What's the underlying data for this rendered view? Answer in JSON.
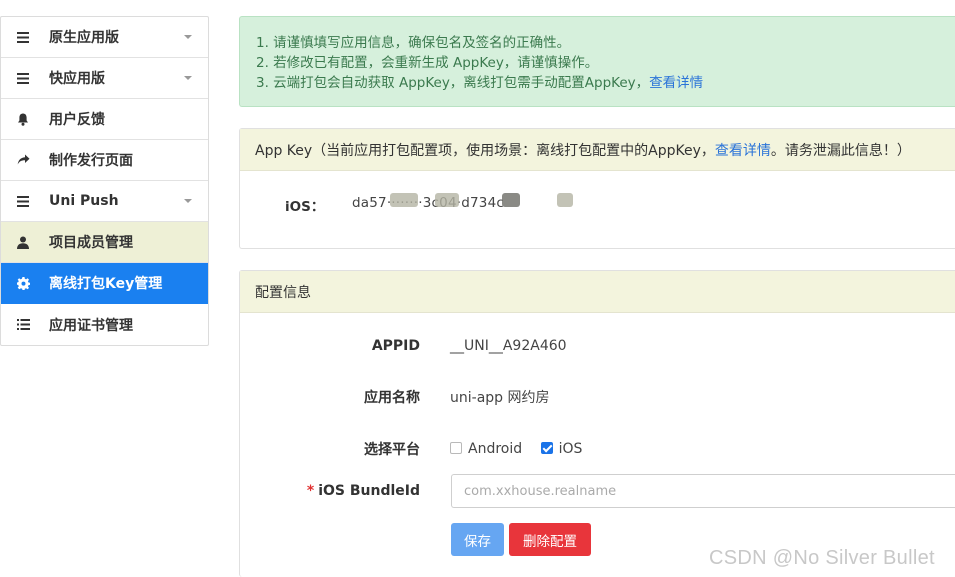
{
  "sidebar": {
    "items": [
      {
        "label": "原生应用版",
        "icon": "menu-icon",
        "has_caret": true
      },
      {
        "label": "快应用版",
        "icon": "menu-icon",
        "has_caret": true
      },
      {
        "label": "用户反馈",
        "icon": "bell-icon",
        "has_caret": false
      },
      {
        "label": "制作发行页面",
        "icon": "share-arrow-icon",
        "has_caret": false
      },
      {
        "label": "Uni Push",
        "icon": "menu-icon",
        "has_caret": true
      },
      {
        "label": "项目成员管理",
        "icon": "user-icon",
        "has_caret": false
      },
      {
        "label": "离线打包Key管理",
        "icon": "gear-icon",
        "has_caret": false,
        "active": true
      },
      {
        "label": "应用证书管理",
        "icon": "list-icon",
        "has_caret": false
      }
    ]
  },
  "notice": {
    "line1": "1. 请谨慎填写应用信息，确保包名及签名的正确性。",
    "line2": "2. 若修改已有配置，会重新生成 AppKey，请谨慎操作。",
    "line3_text": "3. 云端打包会自动获取 AppKey，离线打包需手动配置AppKey，",
    "line3_link": "查看详情"
  },
  "appkey_panel": {
    "head_prefix": "App Key（当前应用打包配置项，使用场景：离线打包配置中的AppKey，",
    "head_link": "查看详情",
    "head_suffix": "。请务泄漏此信息！）",
    "ios_label": "iOS：",
    "ios_value": "da57········3c04·d734c"
  },
  "config_panel": {
    "title": "配置信息",
    "appid_label": "APPID",
    "appid_value": "__UNI__A92A460",
    "appname_label": "应用名称",
    "appname_value": "uni-app 网约房",
    "platform_label": "选择平台",
    "platform_android": "Android",
    "platform_ios": "iOS",
    "android_checked": false,
    "ios_checked": true,
    "bundle_required": "*",
    "bundle_label": "iOS BundleId",
    "bundle_value": "com.xxhouse.realname",
    "save_label": "保存",
    "delete_label": "删除配置"
  },
  "watermark": "CSDN @No Silver Bullet",
  "colors": {
    "active": "#1a80f0",
    "link": "#2a73d8",
    "notice_bg": "#d6f0dc",
    "panel_head_bg": "#f3f4dd",
    "save_btn": "#66a6f2",
    "delete_btn": "#e8353b"
  }
}
